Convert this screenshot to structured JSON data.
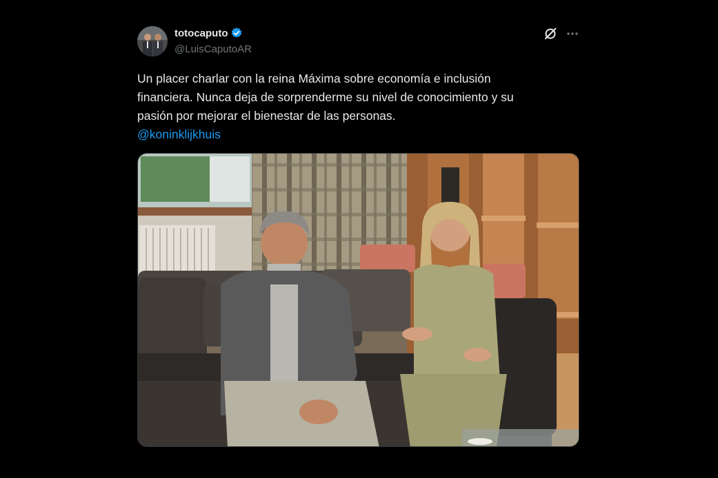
{
  "tweet": {
    "display_name": "totocaputo",
    "handle": "@LuisCaputoAR",
    "verified": true,
    "text_lines": [
      "Un placer charlar con la reina Máxima sobre economía e inclusión",
      "financiera. Nunca deja de sorprenderme su nivel de conocimiento y su",
      "pasión por mejorar el bienestar de las personas."
    ],
    "mention": "@koninklijkhuis"
  },
  "icons": {
    "verified": "verified-badge-icon",
    "grok": "grok-icon",
    "more": "more-options-icon"
  },
  "colors": {
    "background": "#000000",
    "text": "#e7e9ea",
    "secondary": "#71767b",
    "link": "#1d9bf0",
    "verified": "#1d9bf0"
  }
}
